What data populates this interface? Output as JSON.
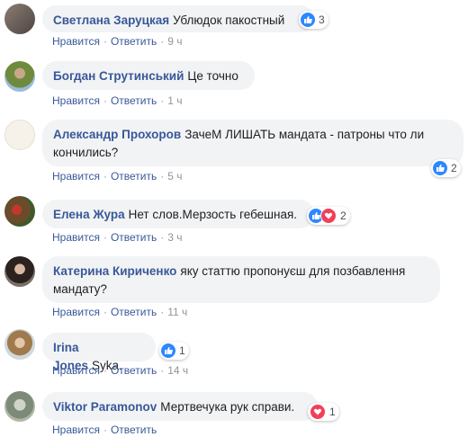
{
  "action_labels": {
    "like": "Нравится",
    "reply": "Ответить",
    "sep": "·"
  },
  "colors": {
    "author": "#385898",
    "bubble": "#f2f3f5",
    "like": "#2d88ff",
    "love": "#f33e58"
  },
  "comments": [
    {
      "author": "Светлана Заруцкая",
      "text": "Ублюдок пакостный",
      "time": "9 ч",
      "reactions": [
        "like-icon"
      ],
      "reaction_count": "3"
    },
    {
      "author": "Богдан Струтинський",
      "text": "Це точно",
      "time": "1 ч",
      "reactions": [],
      "reaction_count": ""
    },
    {
      "author": "Александр Прохоров",
      "text": "ЗачеМ ЛИШАТЬ мандата - патроны что ли кончились?",
      "time": "5 ч",
      "reactions": [
        "like-icon"
      ],
      "reaction_count": "2"
    },
    {
      "author": "Елена Жура",
      "text": "Нет слов.Мерзость гебешная.",
      "time": "3 ч",
      "reactions": [
        "like-icon",
        "love-icon"
      ],
      "reaction_count": "2"
    },
    {
      "author": "Катерина Кириченко",
      "text": "яку статтю пропонуєш для позбавлення мандату?",
      "time": "11 ч",
      "reactions": [],
      "reaction_count": ""
    },
    {
      "author": "Irina Jones",
      "text": "Syka.",
      "time": "14 ч",
      "reactions": [
        "like-icon"
      ],
      "reaction_count": "1"
    },
    {
      "author": "Viktor Paramonov",
      "text": "Мертвечука рук справи.",
      "time": "",
      "reactions": [
        "love-icon"
      ],
      "reaction_count": "1"
    }
  ]
}
